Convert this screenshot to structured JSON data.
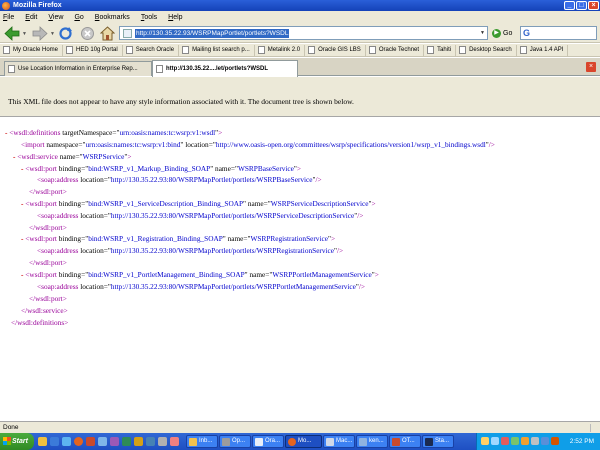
{
  "window": {
    "title": "Mozilla Firefox"
  },
  "menu": [
    {
      "pre": "",
      "key": "F",
      "post": "ile"
    },
    {
      "pre": "",
      "key": "E",
      "post": "dit"
    },
    {
      "pre": "",
      "key": "V",
      "post": "iew"
    },
    {
      "pre": "",
      "key": "G",
      "post": "o"
    },
    {
      "pre": "",
      "key": "B",
      "post": "ookmarks"
    },
    {
      "pre": "",
      "key": "T",
      "post": "ools"
    },
    {
      "pre": "",
      "key": "H",
      "post": "elp"
    }
  ],
  "toolbar": {
    "url": "http://130.35.22.93/WSRPMapPortlet/portlets?WSDL",
    "go_label": "Go",
    "search_value": ""
  },
  "bookmarks": [
    "My Oracle Home",
    "HED 10g Portal",
    "Search Oracle",
    "Mailing list search p...",
    "Metalink 2.0",
    "Oracle GIS LBS",
    "Oracle Technet",
    "Tahiti",
    "Desktop Search",
    "Java 1.4 API"
  ],
  "tabs": [
    {
      "label": "Use Location Information in Enterprise Rep...",
      "active": false
    },
    {
      "label": "http://130.35.22....let/portlets?WSDL",
      "active": true
    }
  ],
  "banner": "This XML file does not appear to have any style information associated with it. The document tree is shown below.",
  "xml": {
    "definitions_open": "<wsdl:definitions",
    "targetNamespace_attr": "targetNamespace",
    "targetNamespace_val": "urn:oasis:names:tc:wsrp:v1:wsdl",
    "import_tag": "<import",
    "namespace_attr": "namespace",
    "import_ns_val": "urn:oasis:names:tc:wsrp:v1:bind",
    "location_attr": "location",
    "import_loc_val": "http://www.oasis-open.org/committees/wsrp/specifications/version1/wsrp_v1_bindings.wsdl",
    "service_open": "<wsdl:service",
    "name_attr": "name",
    "service_name": "WSRPService",
    "port_open": "<wsdl:port",
    "binding_attr": "binding",
    "soap_open": "<soap:address",
    "port_close": "</wsdl:port>",
    "service_close": "</wsdl:service>",
    "definitions_close": "</wsdl:definitions>",
    "ports": [
      {
        "binding": "bind:WSRP_v1_Markup_Binding_SOAP",
        "name": "WSRPBaseService",
        "location": "http://130.35.22.93:80/WSRPMapPortlet/portlets/WSRPBaseService"
      },
      {
        "binding": "bind:WSRP_v1_ServiceDescription_Binding_SOAP",
        "name": "WSRPServiceDescriptionService",
        "location": "http://130.35.22.93:80/WSRPMapPortlet/portlets/WSRPServiceDescriptionService"
      },
      {
        "binding": "bind:WSRP_v1_Registration_Binding_SOAP",
        "name": "WSRPRegistrationService",
        "location": "http://130.35.22.93:80/WSRPMapPortlet/portlets/WSRPRegistrationService"
      },
      {
        "binding": "bind:WSRP_v1_PortletManagement_Binding_SOAP",
        "name": "WSRPPortletManagementService",
        "location": "http://130.35.22.93:80/WSRPMapPortlet/portlets/WSRPPortletManagementService"
      }
    ]
  },
  "status": "Done",
  "taskbar": {
    "start_label": "Start",
    "buttons": [
      {
        "label": "Inb...",
        "active": false,
        "color": "#f2c14e"
      },
      {
        "label": "Op...",
        "active": false,
        "color": "#9c9c9c"
      },
      {
        "label": "Ora...",
        "active": false,
        "color": "#e8eef8"
      },
      {
        "label": "Mo...",
        "active": true,
        "color": "#e3641f"
      },
      {
        "label": "Mac...",
        "active": false,
        "color": "#cfd8e8"
      },
      {
        "label": "ken...",
        "active": false,
        "color": "#8fb3e0"
      },
      {
        "label": "OT...",
        "active": false,
        "color": "#c94a2c"
      },
      {
        "label": "Sta...",
        "active": false,
        "color": "#1b2a50"
      }
    ],
    "clock": "2:52 PM"
  },
  "colors": {
    "tag": "#990099",
    "attr_value": "#0000cc",
    "toggle": "#cc0000",
    "titlebar": "#1f52c9",
    "taskbar": "#245edb"
  }
}
